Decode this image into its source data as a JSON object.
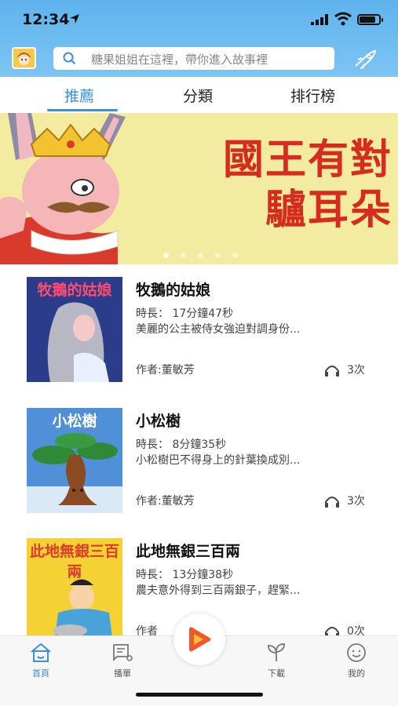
{
  "status": {
    "time": "12:34"
  },
  "search": {
    "placeholder": "糖果姐姐在這裡，帶你進入故事裡"
  },
  "tabs": [
    {
      "label": "推薦",
      "active": true
    },
    {
      "label": "分類",
      "active": false
    },
    {
      "label": "排行榜",
      "active": false
    }
  ],
  "banner": {
    "line1": "國王有對",
    "line2": "驢耳朵",
    "slide_count": 5,
    "active_slide": 1
  },
  "stories": [
    {
      "cover_label": "牧鵝的姑娘",
      "title": "牧鵝的姑娘",
      "duration": "時長：  17分鐘47秒",
      "description": "美麗的公主被侍女強迫對調身份...",
      "author": "作者:董敏芳",
      "plays": "3次"
    },
    {
      "cover_label": "小松樹",
      "title": "小松樹",
      "duration": "時長：  8分鐘35秒",
      "description": "小松樹巴不得身上的針葉換成別...",
      "author": "作者:董敏芳",
      "plays": "3次"
    },
    {
      "cover_label": "此地無銀三百兩",
      "title": "此地無銀三百兩",
      "duration": "時長：  13分鐘38秒",
      "description": "農夫意外得到三百兩銀子，趕緊...",
      "author": "作者",
      "plays": "0次"
    }
  ],
  "tabbar": [
    {
      "label": "首頁",
      "icon": "home-icon",
      "active": true
    },
    {
      "label": "播單",
      "icon": "playlist-icon",
      "active": false
    },
    {
      "label": "下載",
      "icon": "sprout-icon",
      "active": false
    },
    {
      "label": "我的",
      "icon": "face-icon",
      "active": false
    }
  ],
  "colors": {
    "accent": "#3b8ee0",
    "header": "#6bbbf0",
    "banner_bg": "#f3eb9f",
    "banner_text": "#d62b1f",
    "play": "#f0572a"
  }
}
